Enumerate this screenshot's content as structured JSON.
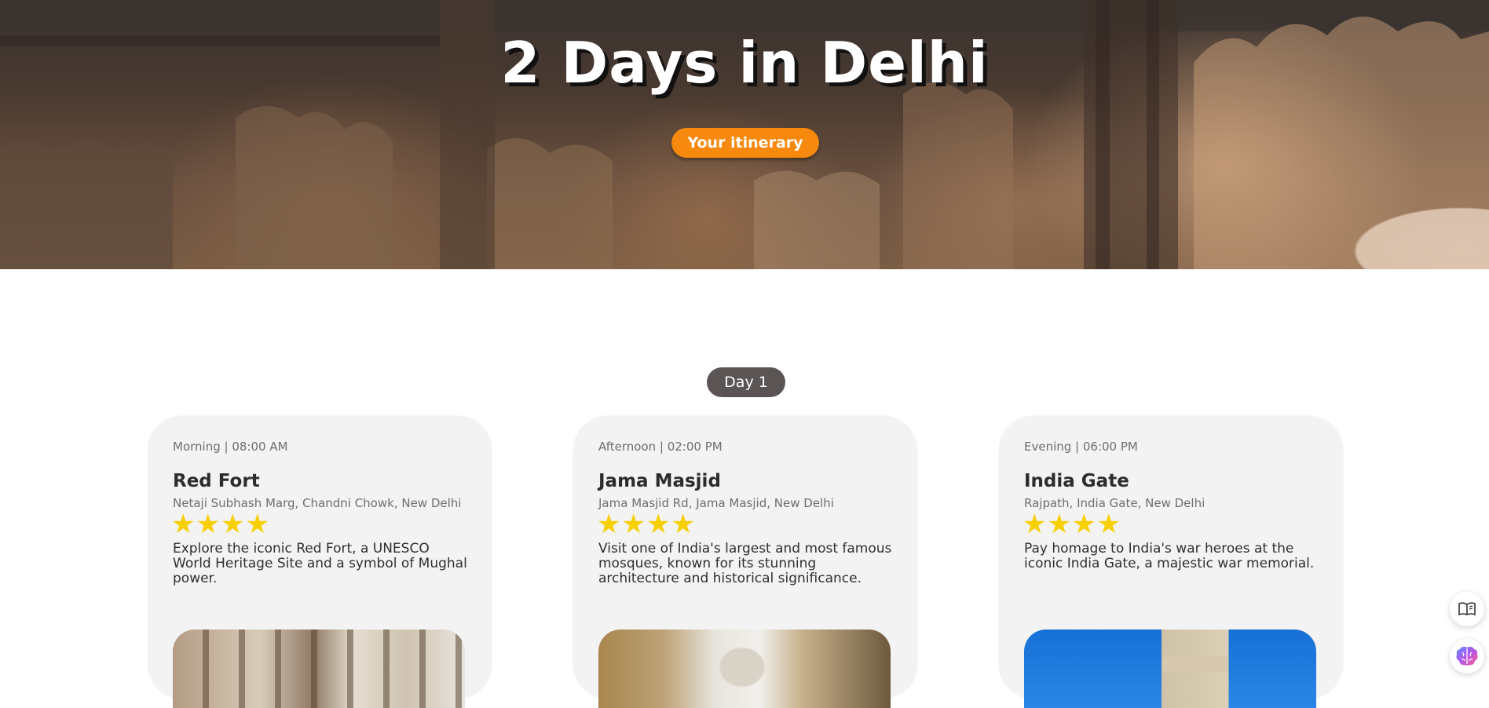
{
  "hero": {
    "title": "2 Days in Delhi",
    "button_label": "Your itinerary"
  },
  "day": {
    "label": "Day 1"
  },
  "cards": [
    {
      "time": "Morning | 08:00 AM",
      "name": "Red Fort",
      "address": "Netaji Subhash Marg, Chandni Chowk, New Delhi",
      "rating": 4,
      "stars": "★★★★",
      "description": "Explore the iconic Red Fort, a UNESCO World Heritage Site and a symbol of Mughal power."
    },
    {
      "time": "Afternoon | 02:00 PM",
      "name": "Jama Masjid",
      "address": "Jama Masjid Rd, Jama Masjid, New Delhi",
      "rating": 4,
      "stars": "★★★★",
      "description": "Visit one of India's largest and most famous mosques, known for its stunning architecture and historical significance."
    },
    {
      "time": "Evening | 06:00 PM",
      "name": "India Gate",
      "address": "Rajpath, India Gate, New Delhi",
      "rating": 4,
      "stars": "★★★★",
      "description": "Pay homage to India's war heroes at the iconic India Gate, a majestic war memorial."
    }
  ],
  "floating": {
    "reader_icon": "book-open-icon",
    "brain_icon": "brain-icon"
  },
  "colors": {
    "accent": "#f6890e",
    "star": "#f8cf00",
    "badge": "#5a5554",
    "card_bg": "#f3f3f3"
  }
}
